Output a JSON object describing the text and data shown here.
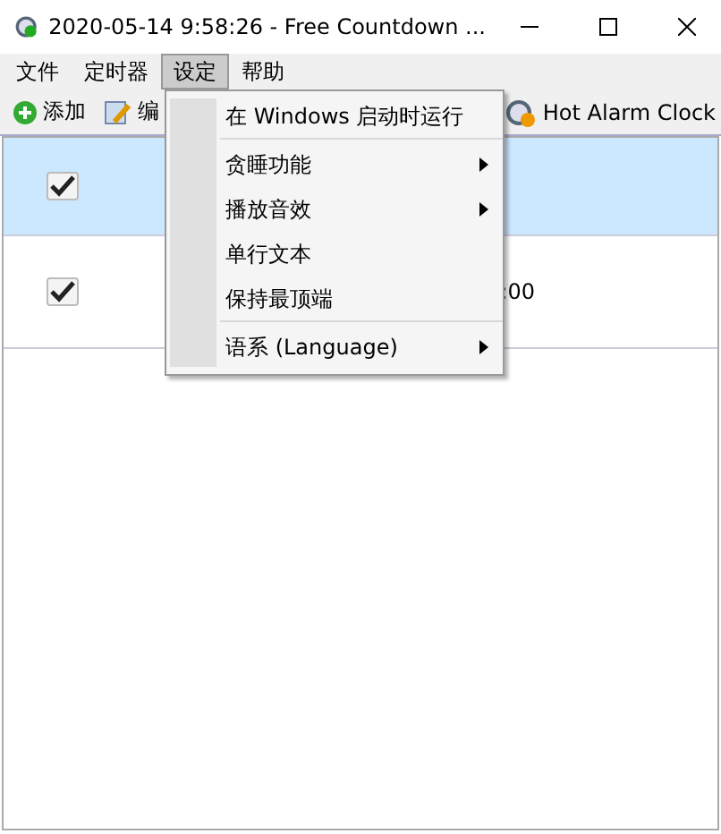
{
  "window": {
    "title": "2020-05-14 9:58:26 - Free Countdown ..."
  },
  "menu_bar": [
    {
      "label": "文件",
      "selected": false
    },
    {
      "label": "定时器",
      "selected": false
    },
    {
      "label": "设定",
      "selected": true
    },
    {
      "label": "帮助",
      "selected": false
    }
  ],
  "toolbar": [
    {
      "kind": "add",
      "label": "添加"
    },
    {
      "kind": "edit",
      "label": "编"
    },
    {
      "kind": "alarm",
      "label": "Hot Alarm Clock"
    }
  ],
  "rows": [
    {
      "checked": true,
      "selected": true,
      "column_3": ""
    },
    {
      "checked": true,
      "selected": false,
      "column_3": ":00"
    }
  ],
  "dropdown": [
    {
      "label": "在 Windows 启动时运行",
      "submenu": false,
      "separator_after": true
    },
    {
      "label": "贪睡功能",
      "submenu": true,
      "separator_after": false
    },
    {
      "label": "播放音效",
      "submenu": true,
      "separator_after": false
    },
    {
      "label": "单行文本",
      "submenu": false,
      "separator_after": false
    },
    {
      "label": "保持最顶端",
      "submenu": false,
      "separator_after": true
    },
    {
      "label": "语系 (Language)",
      "submenu": true,
      "separator_after": false
    }
  ]
}
